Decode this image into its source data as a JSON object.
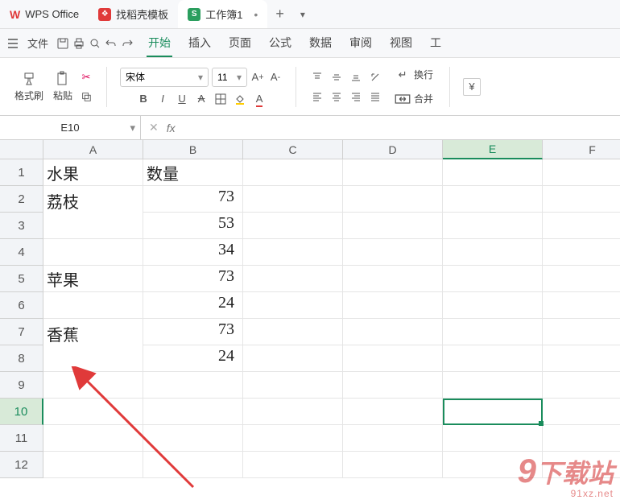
{
  "titlebar": {
    "app_name": "WPS Office",
    "tabs": [
      {
        "label": "找稻壳模板",
        "icon": "docer"
      },
      {
        "label": "工作簿1",
        "icon": "sheet",
        "dirty": true
      }
    ]
  },
  "menubar": {
    "file_label": "文件",
    "ribbon_tabs": [
      "开始",
      "插入",
      "页面",
      "公式",
      "数据",
      "审阅",
      "视图",
      "工"
    ],
    "active_tab": "开始"
  },
  "ribbon": {
    "format_painter": "格式刷",
    "paste": "粘贴",
    "font_name": "宋体",
    "font_size": "11",
    "wrap": "换行",
    "merge": "合并"
  },
  "formula_bar": {
    "name_box": "E10",
    "fx": "fx"
  },
  "grid": {
    "columns": [
      "A",
      "B",
      "C",
      "D",
      "E",
      "F"
    ],
    "row_count": 12,
    "selected_cell": "E10",
    "selected_col_index": 4,
    "selected_row_index": 9,
    "data": {
      "A1": "水果",
      "B1": "数量",
      "A2_3": "荔枝",
      "B2": "73",
      "B3": "53",
      "B4": "34",
      "A5": "苹果",
      "B5": "73",
      "B6": "24",
      "A7_8": "香蕉",
      "B7": "73",
      "B8": "24"
    }
  },
  "chart_data": {
    "type": "table",
    "columns": [
      "水果",
      "数量"
    ],
    "rows": [
      [
        "荔枝",
        73
      ],
      [
        "荔枝",
        53
      ],
      [
        "",
        34
      ],
      [
        "苹果",
        73
      ],
      [
        "",
        24
      ],
      [
        "香蕉",
        73
      ],
      [
        "香蕉",
        24
      ]
    ],
    "note": "Column A contains merged cells: 荔枝 spans rows 2-3, 香蕉 spans rows 7-8"
  },
  "watermark": {
    "main_prefix": "9",
    "main_suffix": "下载站",
    "sub": "91xz.net"
  }
}
